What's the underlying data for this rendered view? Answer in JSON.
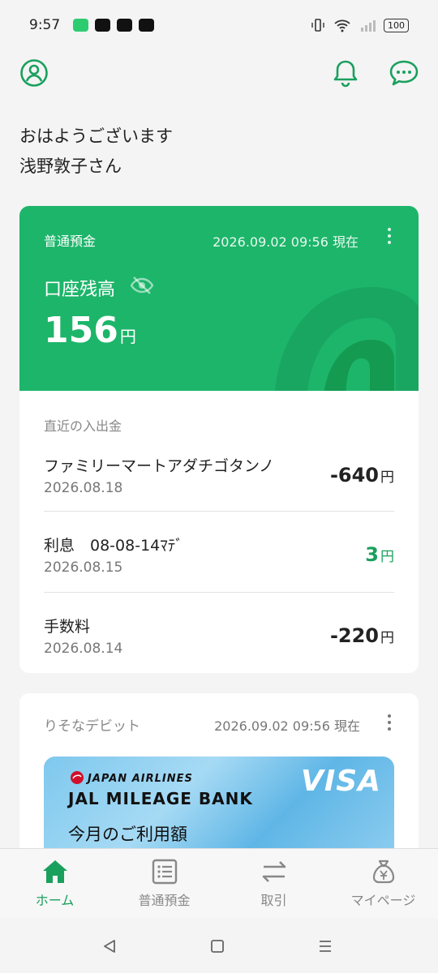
{
  "status_bar": {
    "time": "9:57",
    "battery": "100"
  },
  "greeting": {
    "line1": "おはようございます",
    "line2": "浅野敦子さん"
  },
  "account": {
    "type": "普通預金",
    "as_of": "2026.09.02 09:56 現在",
    "balance_label": "口座残高",
    "balance": "156",
    "unit": "円",
    "recent_label": "直近の入出金",
    "transactions": [
      {
        "name": "ファミリーマートアダチゴタンノ",
        "date": "2026.08.18",
        "amount": "-640",
        "unit": "円"
      },
      {
        "name": "利息　08-08-14ﾏﾃﾞ",
        "date": "2026.08.15",
        "amount": "3",
        "unit": "円"
      },
      {
        "name": "手数料",
        "date": "2026.08.14",
        "amount": "-220",
        "unit": "円"
      }
    ]
  },
  "debit": {
    "label": "りそなデビット",
    "as_of": "2026.09.02 09:56 現在",
    "card_brand": "JAPAN AIRLINES",
    "card_name": "JAL MILEAGE BANK",
    "network": "VISA",
    "usage_label": "今月のご利用額"
  },
  "nav": {
    "items": [
      {
        "label": "ホーム",
        "icon": "home-icon"
      },
      {
        "label": "普通預金",
        "icon": "list-icon"
      },
      {
        "label": "取引",
        "icon": "transfer-icon"
      },
      {
        "label": "マイページ",
        "icon": "money-bag-icon"
      }
    ]
  },
  "colors": {
    "accent": "#1db56a",
    "accent_text": "#1aa05d"
  }
}
